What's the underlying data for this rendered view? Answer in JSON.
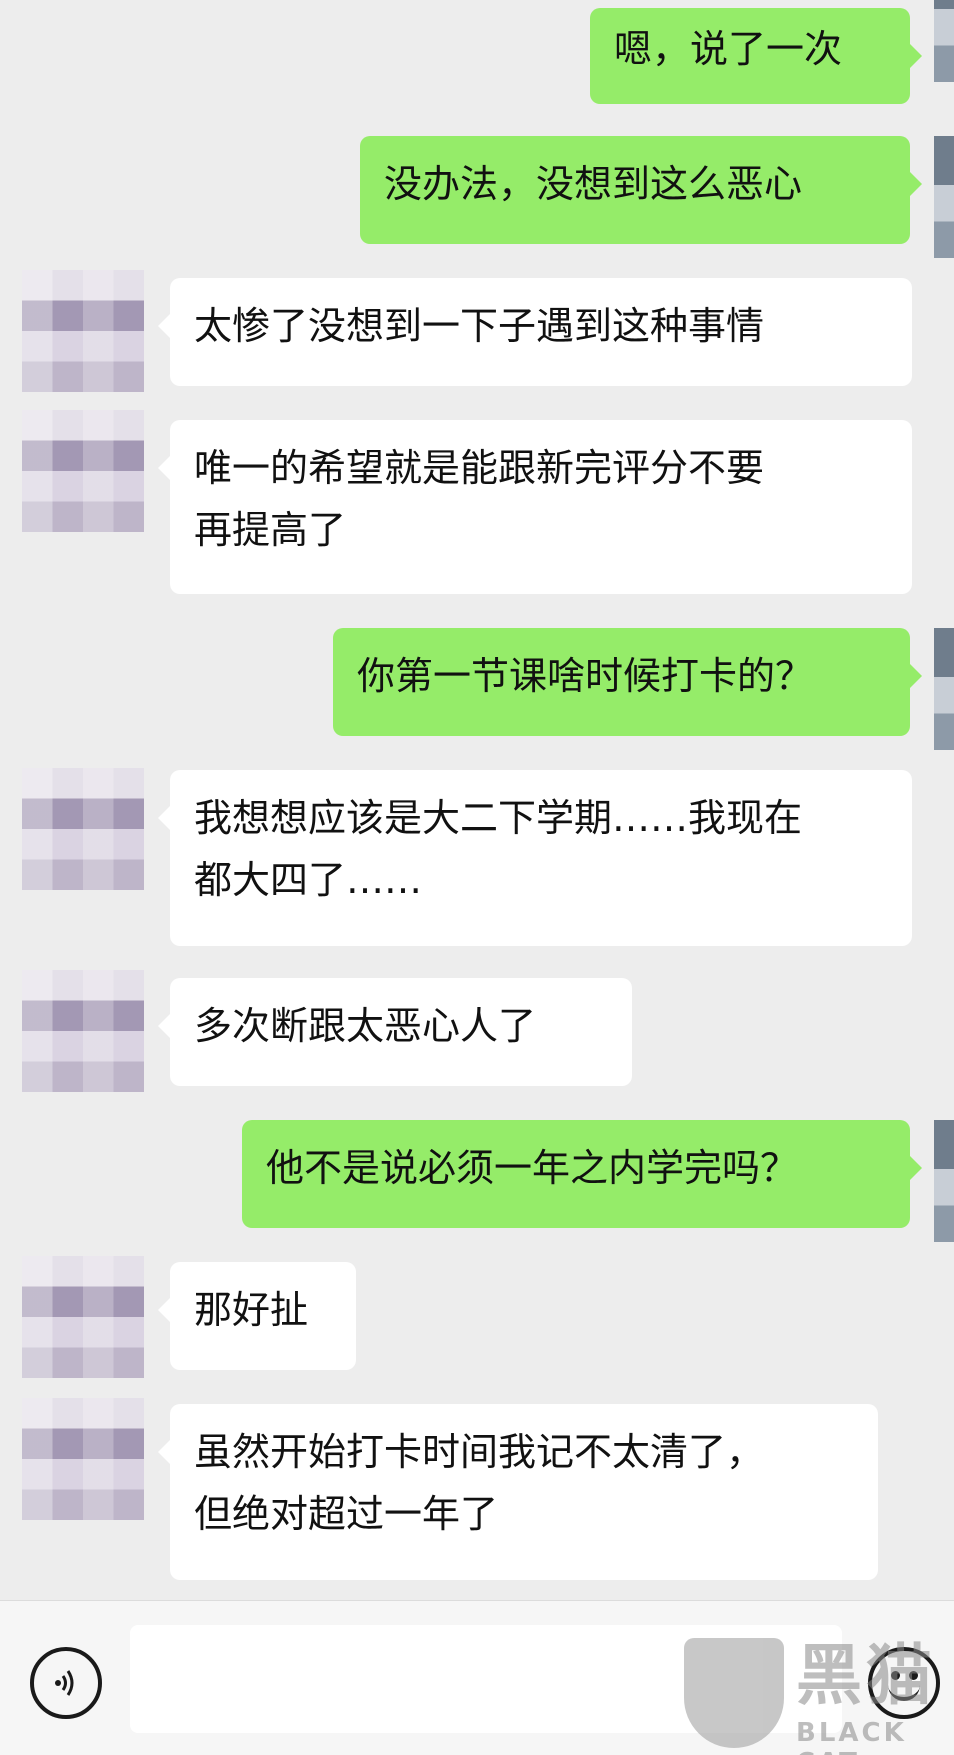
{
  "messages": [
    {
      "side": "self",
      "lines": [
        "嗯，说了一次"
      ]
    },
    {
      "side": "self",
      "lines": [
        "没办法，没想到这么恶心"
      ]
    },
    {
      "side": "other",
      "lines": [
        "太惨了没想到一下子遇到这种事情"
      ]
    },
    {
      "side": "other",
      "lines": [
        "唯一的希望就是能跟新完评分不要",
        "再提高了"
      ]
    },
    {
      "side": "self",
      "lines": [
        "你第一节课啥时候打卡的？"
      ]
    },
    {
      "side": "other",
      "lines": [
        "我想想应该是大二下学期……我现在",
        "都大四了……"
      ]
    },
    {
      "side": "other",
      "lines": [
        "多次断跟太恶心人了"
      ]
    },
    {
      "side": "self",
      "lines": [
        "他不是说必须一年之内学完吗？"
      ]
    },
    {
      "side": "other",
      "lines": [
        "那好扯"
      ]
    },
    {
      "side": "other",
      "lines": [
        "虽然开始打卡时间我记不太清了，",
        "但绝对超过一年了"
      ]
    }
  ],
  "input_bar": {
    "voice_icon": "voice-icon",
    "emoji_icon": "emoji-icon",
    "input_value": ""
  },
  "watermark": {
    "cn": "黑猫",
    "en": "BLACK CAT"
  }
}
